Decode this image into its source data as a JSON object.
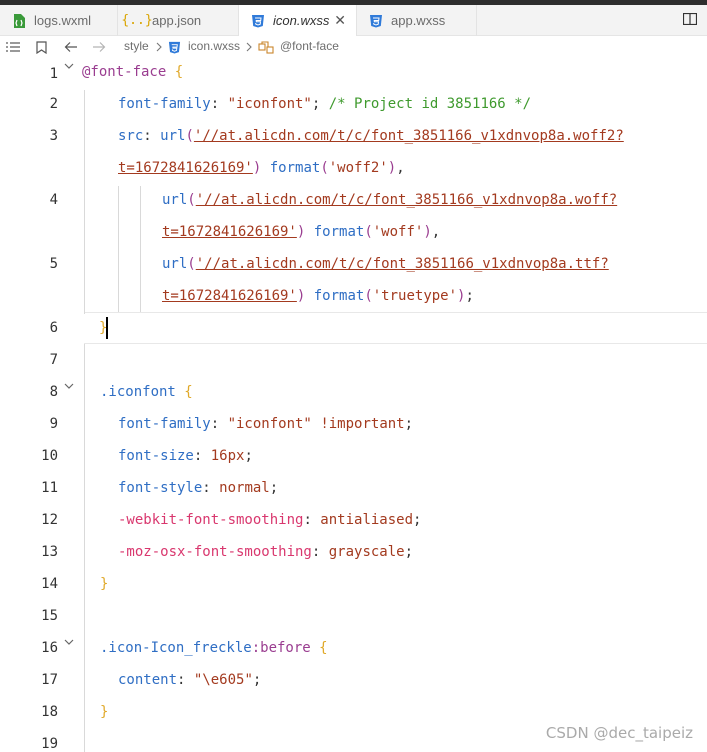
{
  "tabs": [
    {
      "label": "logs.wxml",
      "icon": "file-wxml-icon",
      "color": "#3a9a3a"
    },
    {
      "label": "app.json",
      "icon": "json-braces-icon",
      "color": "#d9a400"
    },
    {
      "label": "icon.wxss",
      "icon": "css-file-icon",
      "color": "#2f7ad9",
      "active": true
    },
    {
      "label": "app.wxss",
      "icon": "css-file-icon",
      "color": "#2f7ad9"
    }
  ],
  "tab_close": "✕",
  "breadcrumb": {
    "style": "style",
    "file": "icon.wxss",
    "symbol": "@font-face"
  },
  "lines": [
    "1",
    "2",
    "3",
    "",
    "4",
    "",
    "5",
    "",
    "6",
    "7",
    "8",
    "9",
    "10",
    "11",
    "12",
    "13",
    "14",
    "15",
    "16",
    "17",
    "18",
    "19"
  ],
  "code": {
    "l1_at": "@font-face",
    "l1_brace": "{",
    "l2_prop": "font-family",
    "l2_val": "\"iconfont\"",
    "l2_comment": "/* Project id 3851166 */",
    "l3_prop": "src",
    "l3_fn": "url",
    "l3_url1": "'//at.alicdn.com/t/c/font_3851166_v1xdnvop8a.woff2?",
    "l3_url2": "t=1672841626169'",
    "l3_fmt": "format",
    "l3_fmtval": "'woff2'",
    "l4_url1": "'//at.alicdn.com/t/c/font_3851166_v1xdnvop8a.woff?",
    "l4_url2": "t=1672841626169'",
    "l4_fmtval": "'woff'",
    "l5_url1": "'//at.alicdn.com/t/c/font_3851166_v1xdnvop8a.ttf?",
    "l5_url2": "t=1672841626169'",
    "l5_fmtval": "'truetype'",
    "l6_brace": "}",
    "l8_sel": ".iconfont",
    "l8_brace": "{",
    "l9_prop": "font-family",
    "l9_val": "\"iconfont\"",
    "l9_imp": "!important",
    "l10_prop": "font-size",
    "l10_val": "16px",
    "l11_prop": "font-style",
    "l11_val": "normal",
    "l12_prop": "-webkit-font-smoothing",
    "l12_val": "antialiased",
    "l13_prop": "-moz-osx-font-smoothing",
    "l13_val": "grayscale",
    "l14_brace": "}",
    "l16_sel": ".icon-Icon_freckle",
    "l16_pseudo": ":before",
    "l16_brace": "{",
    "l17_prop": "content",
    "l17_val": "\"\\e605\"",
    "l18_brace": "}"
  },
  "watermark": "CSDN @dec_taipeiz"
}
